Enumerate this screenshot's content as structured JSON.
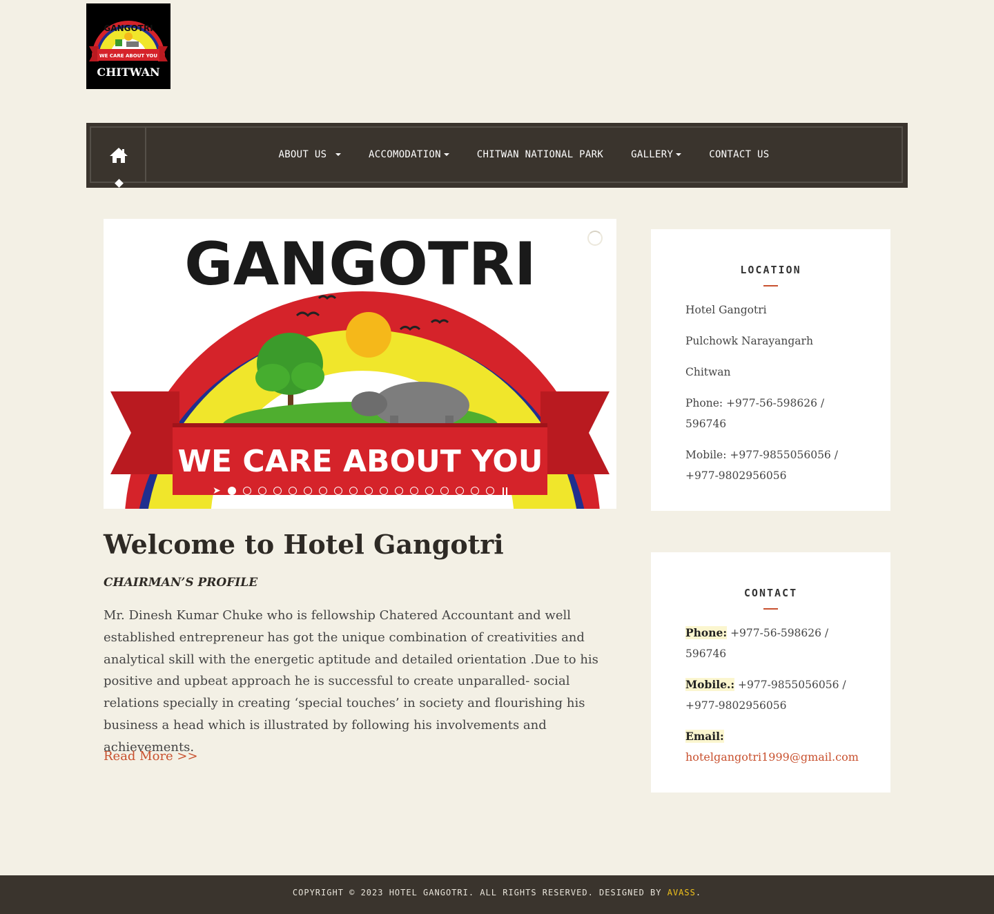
{
  "logo": {
    "top_text": "GANGOTRI",
    "banner_text": "WE CARE ABOUT YOU",
    "bottom_text": "CHITWAN"
  },
  "nav": {
    "home_icon": "home-icon",
    "items": [
      {
        "label": "ABOUT US",
        "dropdown": true
      },
      {
        "label": "ACCOMODATION",
        "dropdown": true
      },
      {
        "label": "CHITWAN NATIONAL PARK",
        "dropdown": false
      },
      {
        "label": "GALLERY",
        "dropdown": true
      },
      {
        "label": "CONTACT US",
        "dropdown": false
      }
    ]
  },
  "slider": {
    "image_top_text": "GANGOTRI",
    "image_banner_text": "WE CARE ABOUT YOU",
    "slide_count": 18,
    "active_slide": 1
  },
  "main": {
    "heading": "Welcome to Hotel Gangotri",
    "subheading": "CHAIRMAN’S PROFILE",
    "body": "Mr. Dinesh Kumar Chuke who is fellowship Chatered Accountant and well established entrepreneur has got the unique combination of creativities and analytical skill with the energetic aptitude and detailed orientation .Due to his positive and upbeat approach he is successful to create unparalled- social relations specially in creating ‘special touches’ in society and flourishing his business a head which is illustrated by following his involvements and achievements.",
    "read_more": "Read More >>"
  },
  "location": {
    "title": "LOCATION",
    "lines": [
      "Hotel Gangotri",
      "Pulchowk Narayangarh",
      "Chitwan",
      "Phone: +977-56-598626 / 596746",
      "Mobile: +977-9855056056 / +977-9802956056"
    ]
  },
  "contact": {
    "title": "CONTACT",
    "phone_label": "Phone:",
    "phone_value": "+977-56-598626 / 596746",
    "mobile_label": "Mobile.:",
    "mobile_value": "+977-9855056056 / +977-9802956056",
    "email_label": "Email:",
    "email_value": "hotelgangotri1999@gmail.com"
  },
  "footer": {
    "text": "COPYRIGHT © 2023 HOTEL GANGOTRI. ALL RIGHTS RESERVED. DESIGNED BY",
    "designer": "AVASS",
    "suffix": "."
  },
  "colors": {
    "background": "#f3f0e5",
    "nav_bg": "#3a342d",
    "accent": "#c8502e",
    "footer_link": "#f2c31b",
    "highlight": "#fbf6cf"
  }
}
